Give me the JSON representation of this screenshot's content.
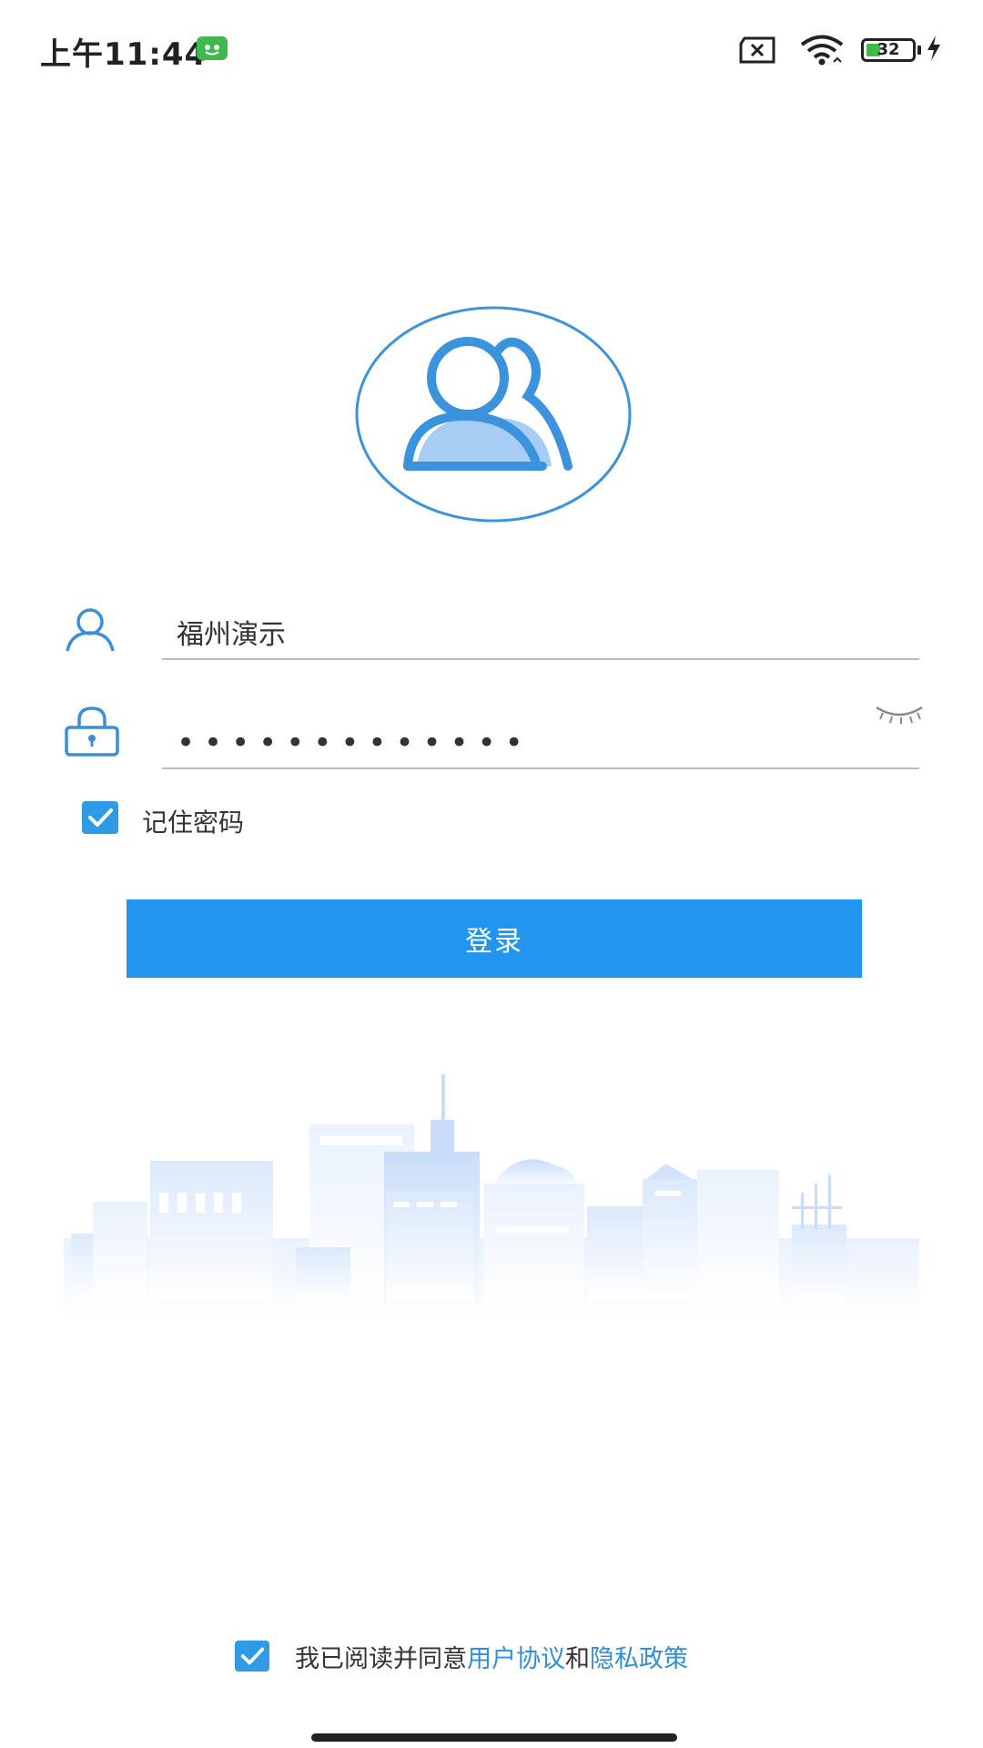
{
  "status_bar": {
    "time": "上午11:44",
    "battery_level": 32,
    "battery_text": "32",
    "icons": [
      "app-notification-icon",
      "sim-error-icon",
      "wifi-icon",
      "battery-icon",
      "charging-icon"
    ]
  },
  "login_form": {
    "username_value": "福州演示",
    "password_mask": "•••••••••••••",
    "password_icon": "eye-closed-icon",
    "remember_label": "记住密码",
    "remember_checked": true,
    "login_button_label": "登录"
  },
  "agreement": {
    "checked": true,
    "prefix": "我已阅读并同意",
    "user_agreement": "用户协议",
    "conjunction": "和",
    "privacy_policy": "隐私政策"
  },
  "colors": {
    "primary": "#2195f0",
    "checkbox": "#2f9be6",
    "link": "#2f8fd8",
    "icon_outline": "#3b8fd6",
    "status_green": "#3fb94e"
  }
}
